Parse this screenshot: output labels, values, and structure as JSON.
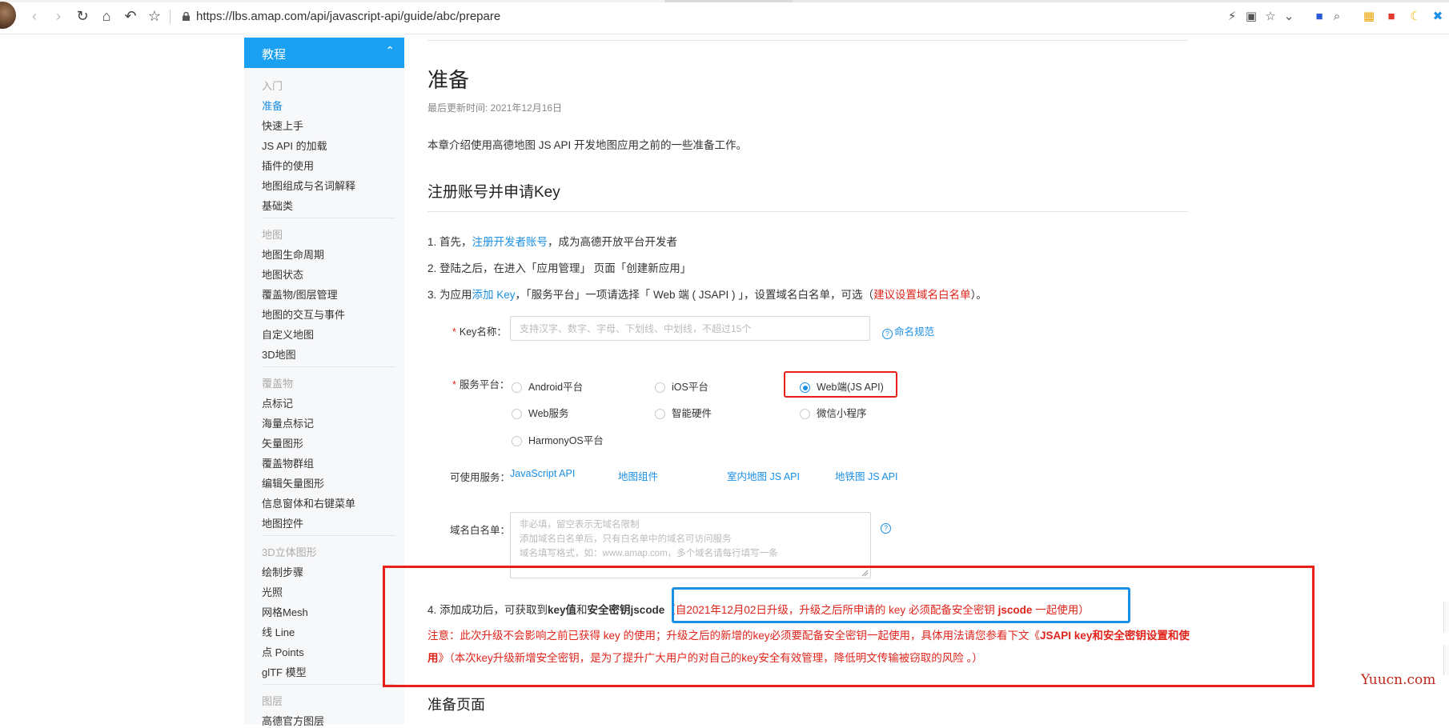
{
  "browser": {
    "url": "https://lbs.amap.com/api/javascript-api/guide/abc/prepare",
    "icons": [
      "back-icon",
      "forward-icon",
      "reload-icon",
      "home-icon",
      "undo-icon",
      "bookmark-star-icon",
      "lock-icon",
      "lightning-icon",
      "qr-icon",
      "star-icon",
      "chevron-down-icon",
      "paw-icon",
      "search-icon",
      "apps-icon",
      "pdf-icon",
      "moon-icon",
      "plugin-icon"
    ]
  },
  "sidebar": {
    "header": "教程",
    "groups": [
      {
        "title": "入门",
        "items": [
          "准备",
          "快速上手",
          "JS API 的加载",
          "插件的使用",
          "地图组成与名词解释",
          "基础类"
        ]
      },
      {
        "title": "地图",
        "items": [
          "地图生命周期",
          "地图状态",
          "覆盖物/图层管理",
          "地图的交互与事件",
          "自定义地图",
          "3D地图"
        ]
      },
      {
        "title": "覆盖物",
        "items": [
          "点标记",
          "海量点标记",
          "矢量图形",
          "覆盖物群组",
          "编辑矢量图形",
          "信息窗体和右键菜单",
          "地图控件"
        ]
      },
      {
        "title": "3D立体图形",
        "items": [
          "绘制步骤",
          "光照",
          "网格Mesh",
          "线 Line",
          "点 Points",
          "glTF 模型"
        ]
      },
      {
        "title": "图层",
        "items": [
          "高德官方图层"
        ]
      }
    ],
    "active": "准备"
  },
  "content": {
    "title": "准备",
    "updated": "最后更新时间: 2021年12月16日",
    "intro": "本章介绍使用高德地图 JS API 开发地图应用之前的一些准备工作。",
    "section1": "注册账号并申请Key",
    "step1": {
      "a": "1. 首先，",
      "link": "注册开发者账号",
      "b": "，成为高德开放平台开发者"
    },
    "step2": "2. 登陆之后，在进入「应用管理」 页面「创建新应用」",
    "step3": {
      "a": "3. 为应用",
      "link": "添加 Key",
      "b": "，「服务平台」一项请选择「 Web 端 ( JSAPI ) 」，设置域名白名单，可选（",
      "red": "建议设置域名白名单",
      "c": "）。"
    },
    "form": {
      "key_name_label": "Key名称：",
      "key_name_placeholder": "支持汉字、数字、字母、下划线、中划线，不超过15个",
      "naming_help": "命名规范",
      "platform_label": "服务平台：",
      "platforms": [
        "Android平台",
        "iOS平台",
        "Web端(JS API)",
        "Web服务",
        "智能硬件",
        "微信小程序",
        "HarmonyOS平台"
      ],
      "selected_platform": "Web端(JS API)",
      "services_label": "可使用服务：",
      "services": [
        "JavaScript API",
        "地图组件",
        "室内地图 JS API",
        "地铁图 JS API"
      ],
      "whitelist_label": "域名白名单：",
      "whitelist_placeholder": [
        "非必填，留空表示无域名限制",
        "添加域名白名单后，只有白名单中的域名可访问服务",
        "域名填写格式，如：www.amap.com，多个域名请每行填写一条"
      ]
    },
    "step4": {
      "a": "4. 添加成功后，可获取到",
      "b1": "key值",
      "b2": "和",
      "b3": "安全密钥jscode",
      "red_a": "（自2021年12月02日升级，升级之后所申请的 key 必须配备安全密钥 ",
      "red_b": "jscode",
      "red_c": " 一起使用）"
    },
    "note": {
      "a": "注意：此次升级不会影响之前已获得 key 的使用；升级之后的新增的key必须要配备安全密钥一起使用，具体用法请您参看下文《",
      "bold": "JSAPI key和安全密钥设置和使用",
      "b": "》（本次key升级新增安全密钥，是为了提升广大用户的对自己的key安全有效管理，降低明文传输被窃取的风险 。）"
    },
    "section2": "准备页面"
  },
  "watermark": "Yuucn.com",
  "colors": {
    "accent": "#1aa0f0",
    "link": "#1a8fe3",
    "red": "#e0241b",
    "highlight_red": "#e7211a"
  }
}
